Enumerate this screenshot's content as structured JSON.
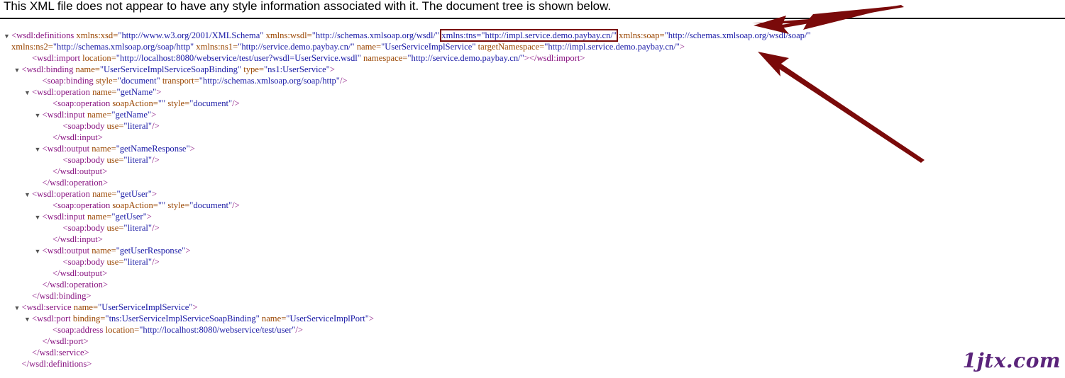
{
  "header": {
    "message": "This XML file does not appear to have any style information associated with it. The document tree is shown below."
  },
  "xml_lines": [
    {
      "indent": 0,
      "toggle": true,
      "segments": [
        {
          "t": "tag",
          "v": "<wsdl:definitions "
        },
        {
          "t": "attr",
          "v": "xmlns:xsd="
        },
        {
          "t": "val",
          "v": "\"http://www.w3.org/2001/XMLSchema\" "
        },
        {
          "t": "attr",
          "v": "xmlns:wsdl="
        },
        {
          "t": "val",
          "v": "\"http://schemas.xmlsoap.org/wsdl/\" "
        },
        {
          "t": "hl",
          "v": "xmlns:tns=\"http://impl.service.demo.paybay.cn/\""
        },
        {
          "t": "plain",
          "v": " "
        },
        {
          "t": "attr",
          "v": "xmlns:soap="
        },
        {
          "t": "val",
          "v": "\"http://schemas.xmlsoap.org/wsdl/soap/\""
        }
      ]
    },
    {
      "indent": 0,
      "toggle": false,
      "pad": 1,
      "segments": [
        {
          "t": "attr",
          "v": "xmlns:ns2="
        },
        {
          "t": "val",
          "v": "\"http://schemas.xmlsoap.org/soap/http\" "
        },
        {
          "t": "attr",
          "v": "xmlns:ns1="
        },
        {
          "t": "val",
          "v": "\"http://service.demo.paybay.cn/\" "
        },
        {
          "t": "attr",
          "v": "name="
        },
        {
          "t": "val",
          "v": "\"UserServiceImplService\" "
        },
        {
          "t": "attr",
          "v": "targetNamespace="
        },
        {
          "t": "val",
          "v": "\"http://impl.service.demo.paybay.cn/\""
        },
        {
          "t": "tag",
          "v": ">"
        }
      ]
    },
    {
      "indent": 2,
      "toggle": false,
      "segments": [
        {
          "t": "tag",
          "v": "<wsdl:import "
        },
        {
          "t": "attr",
          "v": "location="
        },
        {
          "t": "val",
          "v": "\"http://localhost:8080/webservice/test/user?wsdl=UserService.wsdl\" "
        },
        {
          "t": "attr",
          "v": "namespace="
        },
        {
          "t": "val",
          "v": "\"http://service.demo.paybay.cn/\""
        },
        {
          "t": "tag",
          "v": "></wsdl:import>"
        }
      ]
    },
    {
      "indent": 1,
      "toggle": true,
      "segments": [
        {
          "t": "tag",
          "v": "<wsdl:binding "
        },
        {
          "t": "attr",
          "v": "name="
        },
        {
          "t": "val",
          "v": "\"UserServiceImplServiceSoapBinding\" "
        },
        {
          "t": "attr",
          "v": "type="
        },
        {
          "t": "val",
          "v": "\"ns1:UserService\""
        },
        {
          "t": "tag",
          "v": ">"
        }
      ]
    },
    {
      "indent": 3,
      "toggle": false,
      "segments": [
        {
          "t": "tag",
          "v": "<soap:binding "
        },
        {
          "t": "attr",
          "v": "style="
        },
        {
          "t": "val",
          "v": "\"document\" "
        },
        {
          "t": "attr",
          "v": "transport="
        },
        {
          "t": "val",
          "v": "\"http://schemas.xmlsoap.org/soap/http\""
        },
        {
          "t": "tag",
          "v": "/>"
        }
      ]
    },
    {
      "indent": 2,
      "toggle": true,
      "segments": [
        {
          "t": "tag",
          "v": "<wsdl:operation "
        },
        {
          "t": "attr",
          "v": "name="
        },
        {
          "t": "val",
          "v": "\"getName\""
        },
        {
          "t": "tag",
          "v": ">"
        }
      ]
    },
    {
      "indent": 4,
      "toggle": false,
      "segments": [
        {
          "t": "tag",
          "v": "<soap:operation "
        },
        {
          "t": "attr",
          "v": "soapAction="
        },
        {
          "t": "val",
          "v": "\"\" "
        },
        {
          "t": "attr",
          "v": "style="
        },
        {
          "t": "val",
          "v": "\"document\""
        },
        {
          "t": "tag",
          "v": "/>"
        }
      ]
    },
    {
      "indent": 3,
      "toggle": true,
      "segments": [
        {
          "t": "tag",
          "v": "<wsdl:input "
        },
        {
          "t": "attr",
          "v": "name="
        },
        {
          "t": "val",
          "v": "\"getName\""
        },
        {
          "t": "tag",
          "v": ">"
        }
      ]
    },
    {
      "indent": 5,
      "toggle": false,
      "segments": [
        {
          "t": "tag",
          "v": "<soap:body "
        },
        {
          "t": "attr",
          "v": "use="
        },
        {
          "t": "val",
          "v": "\"literal\""
        },
        {
          "t": "tag",
          "v": "/>"
        }
      ]
    },
    {
      "indent": 4,
      "toggle": false,
      "segments": [
        {
          "t": "tag",
          "v": "</wsdl:input>"
        }
      ]
    },
    {
      "indent": 3,
      "toggle": true,
      "segments": [
        {
          "t": "tag",
          "v": "<wsdl:output "
        },
        {
          "t": "attr",
          "v": "name="
        },
        {
          "t": "val",
          "v": "\"getNameResponse\""
        },
        {
          "t": "tag",
          "v": ">"
        }
      ]
    },
    {
      "indent": 5,
      "toggle": false,
      "segments": [
        {
          "t": "tag",
          "v": "<soap:body "
        },
        {
          "t": "attr",
          "v": "use="
        },
        {
          "t": "val",
          "v": "\"literal\""
        },
        {
          "t": "tag",
          "v": "/>"
        }
      ]
    },
    {
      "indent": 4,
      "toggle": false,
      "segments": [
        {
          "t": "tag",
          "v": "</wsdl:output>"
        }
      ]
    },
    {
      "indent": 3,
      "toggle": false,
      "segments": [
        {
          "t": "tag",
          "v": "</wsdl:operation>"
        }
      ]
    },
    {
      "indent": 2,
      "toggle": true,
      "segments": [
        {
          "t": "tag",
          "v": "<wsdl:operation "
        },
        {
          "t": "attr",
          "v": "name="
        },
        {
          "t": "val",
          "v": "\"getUser\""
        },
        {
          "t": "tag",
          "v": ">"
        }
      ]
    },
    {
      "indent": 4,
      "toggle": false,
      "segments": [
        {
          "t": "tag",
          "v": "<soap:operation "
        },
        {
          "t": "attr",
          "v": "soapAction="
        },
        {
          "t": "val",
          "v": "\"\" "
        },
        {
          "t": "attr",
          "v": "style="
        },
        {
          "t": "val",
          "v": "\"document\""
        },
        {
          "t": "tag",
          "v": "/>"
        }
      ]
    },
    {
      "indent": 3,
      "toggle": true,
      "segments": [
        {
          "t": "tag",
          "v": "<wsdl:input "
        },
        {
          "t": "attr",
          "v": "name="
        },
        {
          "t": "val",
          "v": "\"getUser\""
        },
        {
          "t": "tag",
          "v": ">"
        }
      ]
    },
    {
      "indent": 5,
      "toggle": false,
      "segments": [
        {
          "t": "tag",
          "v": "<soap:body "
        },
        {
          "t": "attr",
          "v": "use="
        },
        {
          "t": "val",
          "v": "\"literal\""
        },
        {
          "t": "tag",
          "v": "/>"
        }
      ]
    },
    {
      "indent": 4,
      "toggle": false,
      "segments": [
        {
          "t": "tag",
          "v": "</wsdl:input>"
        }
      ]
    },
    {
      "indent": 3,
      "toggle": true,
      "segments": [
        {
          "t": "tag",
          "v": "<wsdl:output "
        },
        {
          "t": "attr",
          "v": "name="
        },
        {
          "t": "val",
          "v": "\"getUserResponse\""
        },
        {
          "t": "tag",
          "v": ">"
        }
      ]
    },
    {
      "indent": 5,
      "toggle": false,
      "segments": [
        {
          "t": "tag",
          "v": "<soap:body "
        },
        {
          "t": "attr",
          "v": "use="
        },
        {
          "t": "val",
          "v": "\"literal\""
        },
        {
          "t": "tag",
          "v": "/>"
        }
      ]
    },
    {
      "indent": 4,
      "toggle": false,
      "segments": [
        {
          "t": "tag",
          "v": "</wsdl:output>"
        }
      ]
    },
    {
      "indent": 3,
      "toggle": false,
      "segments": [
        {
          "t": "tag",
          "v": "</wsdl:operation>"
        }
      ]
    },
    {
      "indent": 2,
      "toggle": false,
      "segments": [
        {
          "t": "tag",
          "v": "</wsdl:binding>"
        }
      ]
    },
    {
      "indent": 1,
      "toggle": true,
      "segments": [
        {
          "t": "tag",
          "v": "<wsdl:service "
        },
        {
          "t": "attr",
          "v": "name="
        },
        {
          "t": "val",
          "v": "\"UserServiceImplService\""
        },
        {
          "t": "tag",
          "v": ">"
        }
      ]
    },
    {
      "indent": 2,
      "toggle": true,
      "segments": [
        {
          "t": "tag",
          "v": "<wsdl:port "
        },
        {
          "t": "attr",
          "v": "binding="
        },
        {
          "t": "val",
          "v": "\"tns:UserServiceImplServiceSoapBinding\" "
        },
        {
          "t": "attr",
          "v": "name="
        },
        {
          "t": "val",
          "v": "\"UserServiceImplPort\""
        },
        {
          "t": "tag",
          "v": ">"
        }
      ]
    },
    {
      "indent": 4,
      "toggle": false,
      "segments": [
        {
          "t": "tag",
          "v": "<soap:address "
        },
        {
          "t": "attr",
          "v": "location="
        },
        {
          "t": "val",
          "v": "\"http://localhost:8080/webservice/test/user\""
        },
        {
          "t": "tag",
          "v": "/>"
        }
      ]
    },
    {
      "indent": 3,
      "toggle": false,
      "segments": [
        {
          "t": "tag",
          "v": "</wsdl:port>"
        }
      ]
    },
    {
      "indent": 2,
      "toggle": false,
      "segments": [
        {
          "t": "tag",
          "v": "</wsdl:service>"
        }
      ]
    },
    {
      "indent": 1,
      "toggle": false,
      "segments": [
        {
          "t": "tag",
          "v": "</wsdl:definitions>"
        }
      ]
    }
  ],
  "watermark": "1jtx.com",
  "colors": {
    "tag": "#881280",
    "attr_name": "#994500",
    "attr_value": "#1a1aa6",
    "highlight_box": "#7a0a0a",
    "arrow": "#7a0a0a",
    "watermark": "#5a237a"
  }
}
